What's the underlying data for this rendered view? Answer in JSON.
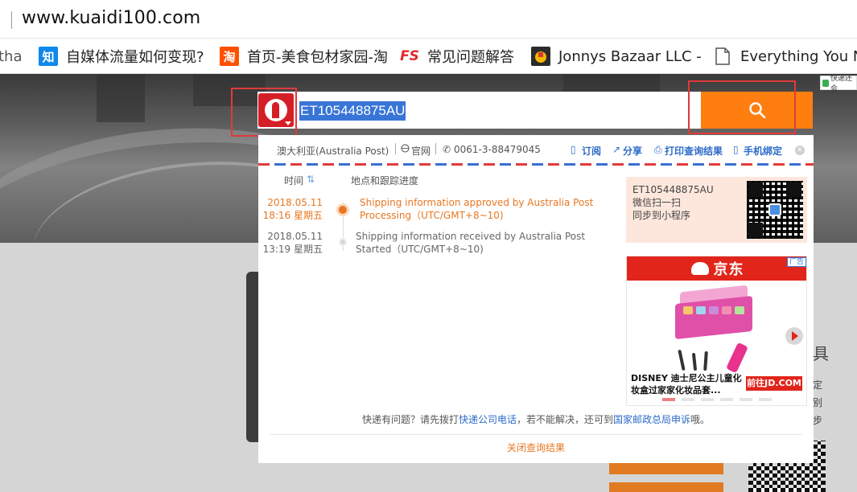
{
  "browser": {
    "url": "www.kuaidi100.com",
    "bookmarks": [
      {
        "icon": "generic-page-icon",
        "label": "tha"
      },
      {
        "icon": "zhihu-icon",
        "label": "自媒体流量如何变现?",
        "icon_color": "#0f88eb",
        "icon_text": "知"
      },
      {
        "icon": "taobao-icon",
        "label": "首页-美食包材家园-淘",
        "icon_color": "#ff5000",
        "icon_text": "淘"
      },
      {
        "icon": "fs-icon",
        "label": "常见问题解答",
        "icon_text": "FS"
      },
      {
        "icon": "jonnys-bazaar-icon",
        "label": "Jonnys Bazaar LLC -"
      },
      {
        "icon": "document-icon",
        "label": "Everything You N"
      }
    ]
  },
  "brand_tag": "快递还会",
  "search": {
    "carrier_logo": "australia-post-logo",
    "tracking_number": "ET105448875AU",
    "search_icon": "magnifier-icon"
  },
  "result": {
    "carrier_name": "澳大利亚(Australia Post)",
    "official_site_label": "官网",
    "phone": "0061-3-88479045",
    "actions": {
      "subscribe": "订阅",
      "share": "分享",
      "print": "打印查询结果",
      "phone_bind": "手机绑定"
    },
    "columns": {
      "time": "时间",
      "progress": "地点和跟踪进度"
    },
    "events": [
      {
        "date": "2018.05.11",
        "time": "18:16 星期五",
        "desc": "Shipping information approved by Australia Post Processing（UTC/GMT+8~10)",
        "current": true
      },
      {
        "date": "2018.05.11",
        "time": "13:19  星期五",
        "desc": "Shipping information received by Australia Post Started（UTC/GMT+8~10)",
        "current": false
      }
    ],
    "wechat": {
      "number": "ET105448875AU",
      "line1": "微信扫一扫",
      "line2": "同步到小程序"
    },
    "ad": {
      "brand": "京东",
      "ad_tag": "广告",
      "title": "DISNEY 迪士尼公主儿童化妆盒过家家化妆品套...",
      "cta": "前往JD.COM"
    },
    "footer": {
      "prefix": "快递有问题？请先拨打",
      "link1": "快递公司电话",
      "middle": "，若不能解决，还可到",
      "link2": "国家邮政总局申诉",
      "suffix": "哦。"
    },
    "close_label": "关闭查询结果"
  },
  "page_side": {
    "side_title_fragment": "具",
    "side_lines": [
      "定",
      "别",
      "步"
    ]
  },
  "colors": {
    "accent_orange": "#ff7e10",
    "link_blue": "#2c6bc9",
    "current_event_orange": "#e87722",
    "jd_red": "#e1251b",
    "highlight_box_red": "#e03a3a"
  }
}
